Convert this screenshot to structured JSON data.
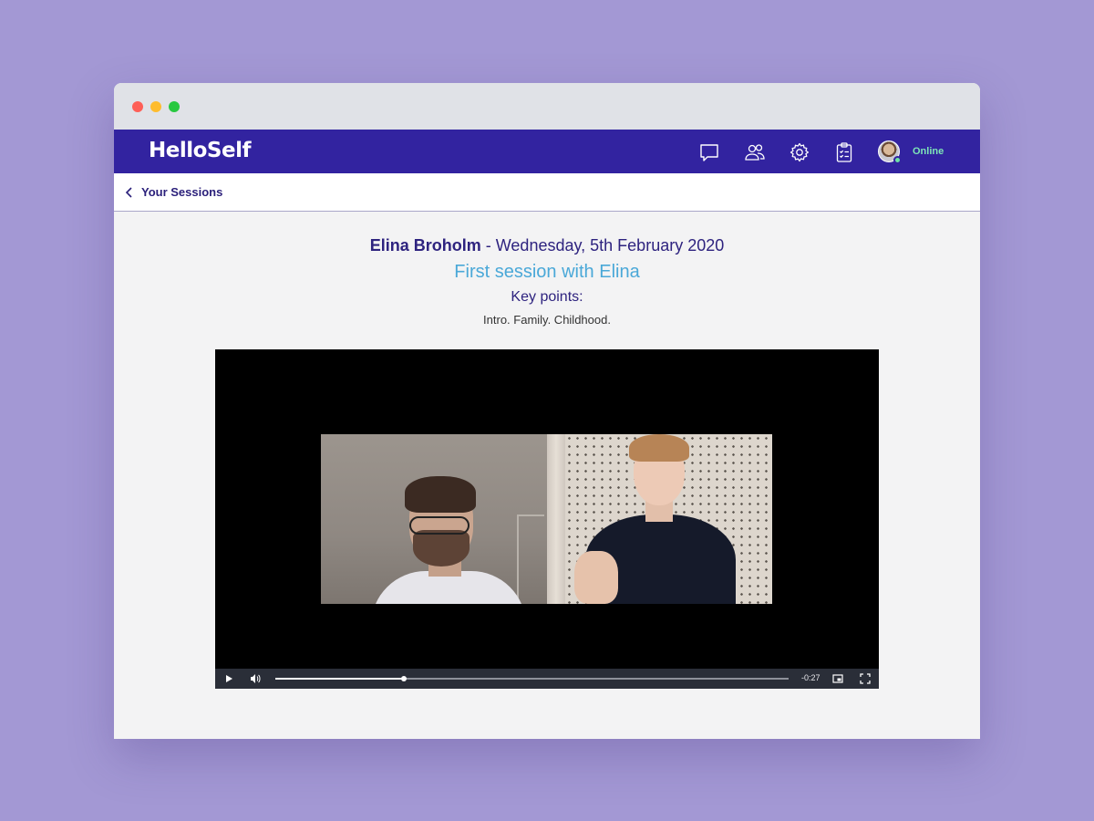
{
  "app": {
    "name": "HelloSelf"
  },
  "navbar": {
    "icons": [
      "chat-icon",
      "people-icon",
      "gear-icon",
      "clipboard-icon"
    ],
    "status": "Online",
    "colors": {
      "bar": "#3223a0",
      "status": "#7ee6b7"
    }
  },
  "subheader": {
    "back_label": "Your Sessions"
  },
  "session": {
    "client_name": "Elina Broholm",
    "date_text": " - Wednesday, 5th February 2020",
    "title": "First session with Elina",
    "key_points_label": "Key points:",
    "key_points": "Intro. Family. Childhood."
  },
  "player": {
    "time_remaining": "-0:27",
    "progress": 0.25
  }
}
